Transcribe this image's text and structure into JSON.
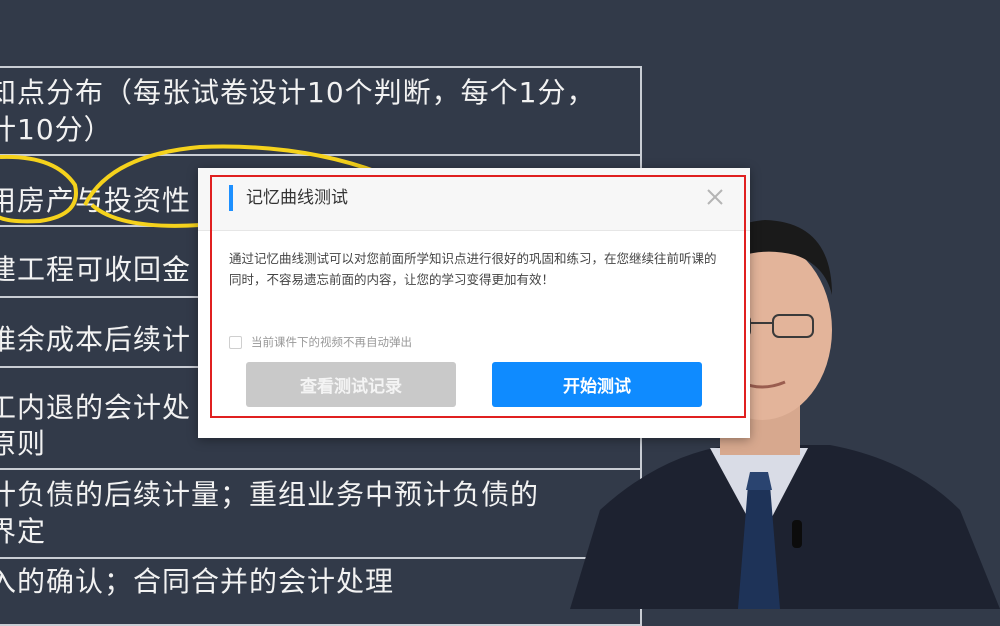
{
  "slide": {
    "lines": [
      "知点分布（每张试卷设计10个判断，每个1分，",
      "计10分）",
      "用房产与投资性",
      "建工程可收回金",
      "推余成本后续计",
      "工内退的会计处",
      "原则",
      "计负债的后续计量；重组业务中预计负债的",
      "界定",
      "入的确认；合同合并的会计处理"
    ]
  },
  "dialog": {
    "title": "记忆曲线测试",
    "close_label": "×",
    "body": "通过记忆曲线测试可以对您前面所学知识点进行很好的巩固和练习，在您继续往前听课的同时，不容易遗忘前面的内容，让您的学习变得更加有效！",
    "checkbox_label": "当前课件下的视频不再自动弹出",
    "checkbox_checked": false,
    "history_button": "查看测试记录",
    "start_button": "开始测试"
  },
  "colors": {
    "accent": "#0f8bff",
    "highlight": "#e02020",
    "slide_background": "#323a49"
  }
}
